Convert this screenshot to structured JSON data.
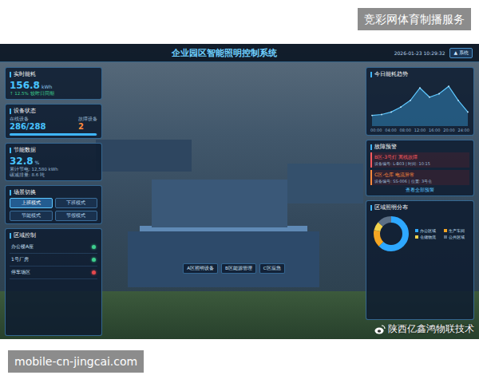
{
  "header_label": "竞彩网体育制播服务",
  "footer_label": "mobile-cn-jingcai.com",
  "dashboard": {
    "title": "企业园区智能照明控制系统",
    "datetime": "2026-01-23 10:29:32",
    "user_button": "▲ 系统"
  },
  "energy": {
    "title": "实时能耗",
    "value": "156.8",
    "unit": "kWh",
    "change": "↑ 12.5% 较昨日同期"
  },
  "devices": {
    "title": "设备状态",
    "online_label": "在线设备",
    "online": "286/288",
    "fault_label": "故障设备",
    "fault": "2",
    "level": 0.99
  },
  "saving": {
    "title": "节能数据",
    "value": "32.8",
    "unit": "%",
    "lines": [
      "累计节电: 12,580 kWh",
      "碳减排量: 8.6 吨"
    ]
  },
  "scenes": {
    "title": "场景切换",
    "items": [
      {
        "label": "上班模式",
        "selected": true
      },
      {
        "label": "下班模式",
        "selected": false
      },
      {
        "label": "节能模式",
        "selected": false
      },
      {
        "label": "节假模式",
        "selected": false
      }
    ]
  },
  "zones": {
    "title": "区域控制",
    "items": [
      {
        "name": "办公楼A座",
        "on": true
      },
      {
        "name": "1号厂房",
        "on": true
      },
      {
        "name": "停车场区",
        "on": false
      }
    ]
  },
  "center_buttons": [
    "A区照明设备",
    "B区能源管理",
    "C区应急"
  ],
  "trend": {
    "title": "今日能耗趋势",
    "x_labels": [
      "00:00",
      "04:00",
      "08:00",
      "12:00",
      "16:00",
      "20:00",
      "24:00"
    ],
    "values": [
      22,
      24,
      30,
      42,
      58,
      88,
      66,
      74,
      92,
      58,
      30
    ]
  },
  "alerts": {
    "title": "故障预警",
    "items": [
      {
        "title": "B区-3号灯 离线故障",
        "detail": "设备编号: L-B03 | 时间: 10:15",
        "color": "#ff5a5f"
      },
      {
        "title": "C区-仓库 电流异常",
        "detail": "设备编号: SS-006 | 位置: 3号仓",
        "color": "#ff8a3d"
      }
    ],
    "link": "查看全部预警"
  },
  "distribution": {
    "title": "区域照明分布",
    "items": [
      {
        "label": "办公区域",
        "value": 62,
        "color": "#2ea8ff"
      },
      {
        "label": "生产车间",
        "value": 16,
        "color": "#f5a623"
      },
      {
        "label": "仓储物流",
        "value": 8,
        "color": "#f2d24b"
      },
      {
        "label": "公共区域",
        "value": 14,
        "color": "#5b6f86"
      }
    ]
  },
  "watermark": "陕西亿鑫鸿物联技术"
}
